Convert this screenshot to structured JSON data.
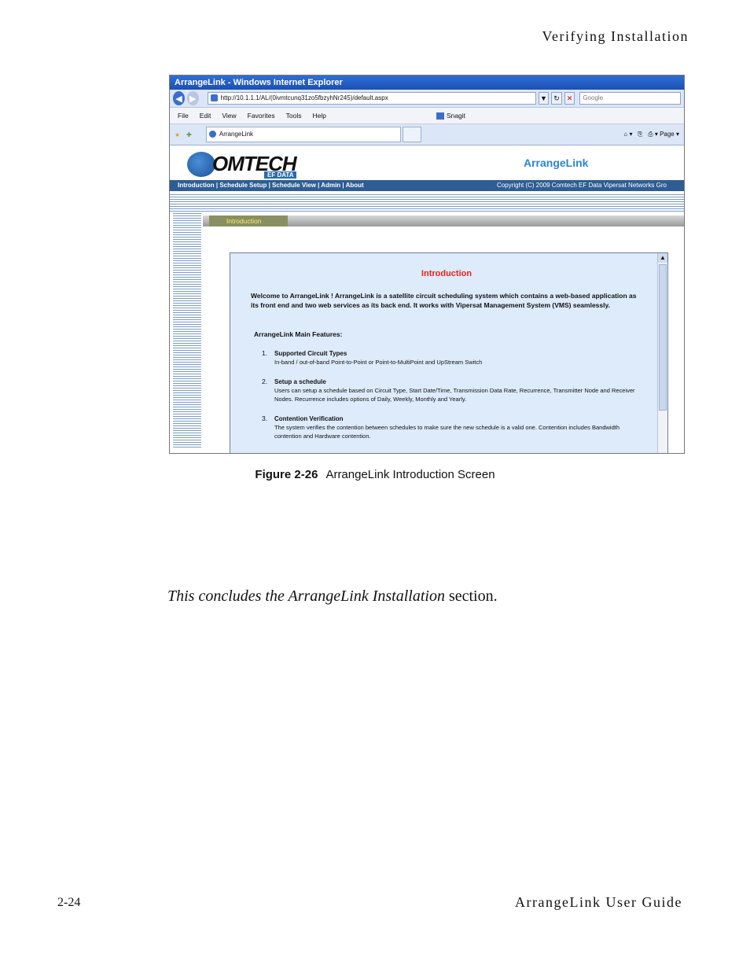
{
  "header": {
    "section_title": "Verifying Installation"
  },
  "screenshot": {
    "window_title": "ArrangeLink - Windows Internet Explorer",
    "address": "http://10.1.1.1/AL/(0ivmtcunq31zo5fbzyhNr245)/default.aspx",
    "search_placeholder": "Google",
    "menu": [
      "File",
      "Edit",
      "View",
      "Favorites",
      "Tools",
      "Help"
    ],
    "snagit": "Snagit",
    "tab_label": "ArrangeLink",
    "tools_label": "Page",
    "logo_text": "OMTECH",
    "logo_sub": "EF DATA",
    "app_name": "ArrangeLink",
    "nav_links": "Introduction  |  Schedule Setup  |  Schedule View  |  Admin  |  About",
    "copyright": "Copyright (C) 2009    Comtech EF Data Vipersat Networks Gro",
    "section_tab": "Introduction",
    "intro_title": "Introduction",
    "intro_text": "Welcome to ArrangeLink !  ArrangeLink is a satellite circuit scheduling system which contains a web-based application as its front end and two web services as its back end.  It works with Vipersat Management System (VMS) seamlessly.",
    "features_heading": "ArrangeLink Main Features:",
    "features": [
      {
        "num": "1.",
        "title": "Supported Circuit Types",
        "desc": "In-band / out-of-band Point-to-Point or Point-to-MultiPoint and UpStream Switch"
      },
      {
        "num": "2.",
        "title": "Setup a schedule",
        "desc": "Users can setup a schedule based on Circuit Type, Start Date/Time, Transmission Data Rate, Recurrence, Transmitter Node and Receiver Nodes.  Recurrence includes options of Daily, Weekly, Monthly and Yearly."
      },
      {
        "num": "3.",
        "title": "Contention Verification",
        "desc": "The system verifies the contention between schedules to make sure the new schedule is a valid one. Contention includes Bandwidth contention and Hardware contention."
      }
    ]
  },
  "caption": {
    "label": "Figure 2-26",
    "text": "ArrangeLink Introduction Screen"
  },
  "conclusion": {
    "italic": "This concludes the ArrangeLink Installation",
    "rest": " section."
  },
  "footer": {
    "page_number": "2-24",
    "guide_title": "ArrangeLink User Guide"
  }
}
